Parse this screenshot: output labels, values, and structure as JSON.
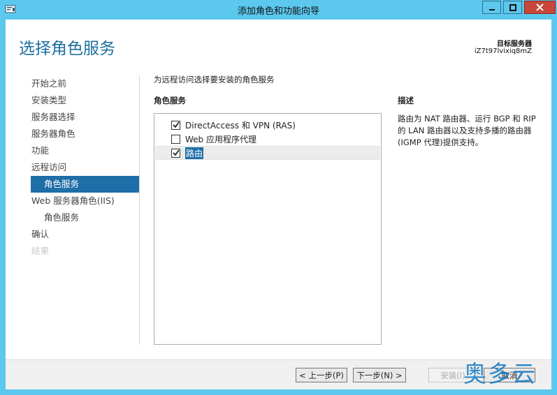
{
  "window": {
    "title": "添加角色和功能向导",
    "colors": {
      "titlebar": "#5cc8ee",
      "close": "#c7473b",
      "accent": "#1e6ea7",
      "title": "#1d6f9e"
    }
  },
  "header": {
    "page_title": "选择角色服务",
    "target_label": "目标服务器",
    "target_value": "iZ7t97lvixiq8mZ"
  },
  "nav": {
    "items": [
      {
        "label": "开始之前",
        "state": "normal"
      },
      {
        "label": "安装类型",
        "state": "normal"
      },
      {
        "label": "服务器选择",
        "state": "normal"
      },
      {
        "label": "服务器角色",
        "state": "normal"
      },
      {
        "label": "功能",
        "state": "normal"
      },
      {
        "label": "远程访问",
        "state": "normal"
      },
      {
        "label": "角色服务",
        "state": "active"
      },
      {
        "label": "Web 服务器角色(IIS)",
        "state": "normal"
      },
      {
        "label": "角色服务",
        "state": "normal"
      },
      {
        "label": "确认",
        "state": "normal"
      },
      {
        "label": "结果",
        "state": "disabled"
      }
    ]
  },
  "main": {
    "instruction": "为远程访问选择要安装的角色服务",
    "list_header": "角色服务",
    "services": [
      {
        "label": "DirectAccess 和 VPN (RAS)",
        "checked": true
      },
      {
        "label": "Web 应用程序代理",
        "checked": false
      },
      {
        "label": "路由",
        "checked": true,
        "selected": true
      }
    ],
    "description_header": "描述",
    "description_text": "路由为 NAT 路由器、运行 BGP 和 RIP 的 LAN 路由器以及支持多播的路由器(IGMP 代理)提供支持。"
  },
  "footer": {
    "prev_label": "< 上一步(P)",
    "next_label": "下一步(N) >",
    "install_label": "安装(I)",
    "cancel_label": "取消"
  },
  "watermark": "奥多云"
}
